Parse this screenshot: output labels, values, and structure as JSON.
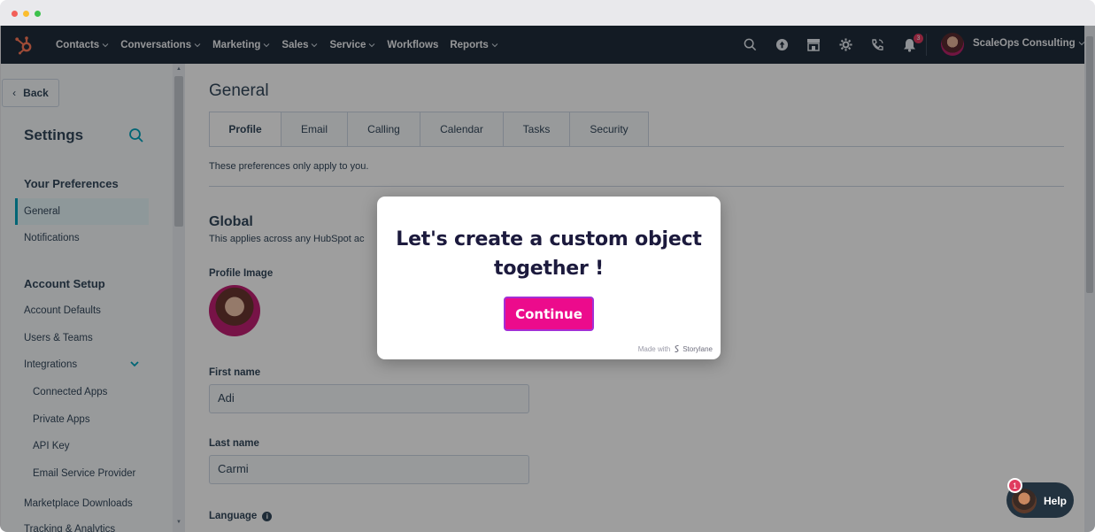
{
  "nav": {
    "items": [
      {
        "label": "Contacts",
        "dropdown": true
      },
      {
        "label": "Conversations",
        "dropdown": true
      },
      {
        "label": "Marketing",
        "dropdown": true
      },
      {
        "label": "Sales",
        "dropdown": true
      },
      {
        "label": "Service",
        "dropdown": true
      },
      {
        "label": "Workflows",
        "dropdown": false
      },
      {
        "label": "Reports",
        "dropdown": true
      }
    ],
    "icons": [
      "search-icon",
      "upgrade-icon",
      "marketplace-icon",
      "settings-icon",
      "calling-icon",
      "notifications-icon"
    ],
    "notification_count": "3",
    "account_name": "ScaleOps Consulting"
  },
  "sidebar": {
    "back_label": "Back",
    "title": "Settings",
    "sections": [
      {
        "title": "Your Preferences",
        "items": [
          "General",
          "Notifications"
        ]
      },
      {
        "title": "Account Setup",
        "items": [
          "Account Defaults",
          "Users & Teams",
          "Integrations"
        ]
      }
    ],
    "sub_items": [
      "Connected Apps",
      "Private Apps",
      "API Key",
      "Email Service Provider"
    ],
    "extra_items": [
      "Marketplace Downloads",
      "Tracking & Analytics"
    ]
  },
  "main": {
    "title": "General",
    "tabs": [
      "Profile",
      "Email",
      "Calling",
      "Calendar",
      "Tasks",
      "Security"
    ],
    "pref_note": "These preferences only apply to you.",
    "global_title": "Global",
    "global_sub": "This applies across any HubSpot ac",
    "profile_image_label": "Profile Image",
    "first_name_label": "First name",
    "first_name_value": "Adi",
    "last_name_label": "Last name",
    "last_name_value": "Carmi",
    "language_label": "Language"
  },
  "modal": {
    "title": "Let's create a custom object together !",
    "button": "Continue",
    "made_with": "Made with",
    "brand": "Storylane"
  },
  "help": {
    "label": "Help",
    "badge": "1"
  },
  "colors": {
    "nav_bg": "#1f2c3a",
    "accent": "#00a4bd",
    "cta": "#ec0b8c",
    "cta_border": "#a32fd6"
  }
}
